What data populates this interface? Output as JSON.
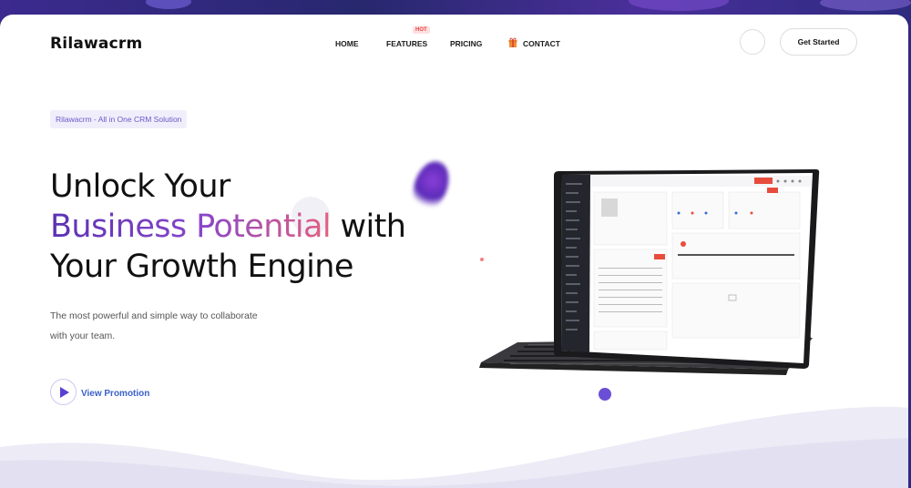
{
  "brand": {
    "name": "Rilawacrm"
  },
  "nav": {
    "home": "HOME",
    "features": "FEATURES",
    "features_badge": "HOT",
    "pricing": "PRICING",
    "contact": "CONTACT"
  },
  "header": {
    "cta": "Get Started"
  },
  "hero": {
    "tag": "Rilawacrm - All in One CRM Solution",
    "line1": "Unlock Your",
    "line2_highlight": "Business Potential",
    "line2_rest": " with",
    "line3": "Your Growth Engine",
    "subtitle_line1": "The most powerful and simple way to collaborate",
    "subtitle_line2": "with your team.",
    "promo_label": "View Promotion"
  },
  "colors": {
    "accent": "#5b3fd0",
    "gradient_start": "#5b32b4",
    "gradient_end": "#e4607e",
    "link": "#3a61c9"
  },
  "icons": [
    "gift-icon",
    "play-icon"
  ]
}
